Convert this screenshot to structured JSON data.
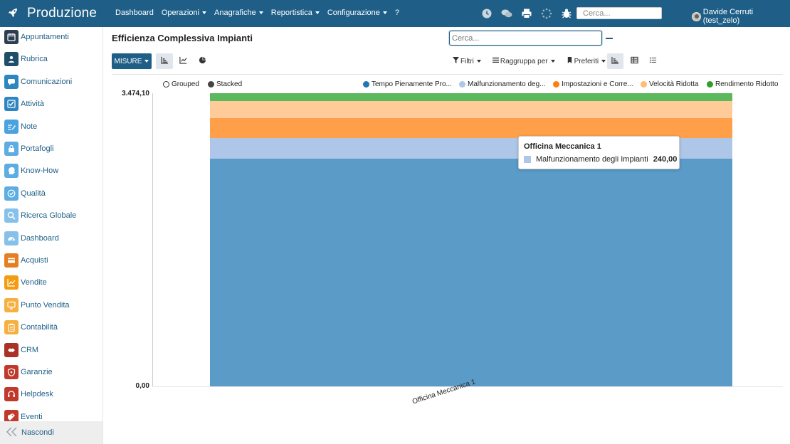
{
  "app": {
    "title": "Produzione"
  },
  "top_menu": [
    {
      "label": "Dashboard",
      "dropdown": false
    },
    {
      "label": "Operazioni",
      "dropdown": true
    },
    {
      "label": "Anagrafiche",
      "dropdown": true
    },
    {
      "label": "Reportistica",
      "dropdown": true
    },
    {
      "label": "Configurazione",
      "dropdown": true
    },
    {
      "label": "?",
      "dropdown": false
    }
  ],
  "top_icons": [
    "clock-icon",
    "chat-icon",
    "print-icon",
    "loading-icon",
    "bug-icon"
  ],
  "top_search": {
    "placeholder": "Cerca..."
  },
  "user": {
    "name": "Davide Cerruti (test_zelo)"
  },
  "sidebar": {
    "items": [
      {
        "label": "Appuntamenti",
        "icon": "calendar-icon",
        "color": "#2c3e50"
      },
      {
        "label": "Rubrica",
        "icon": "contacts-icon",
        "color": "#1f4e6b"
      },
      {
        "label": "Comunicazioni",
        "icon": "speech-bubble-icon",
        "color": "#2e86c1"
      },
      {
        "label": "Attività",
        "icon": "checkbox-icon",
        "color": "#2e86c1"
      },
      {
        "label": "Note",
        "icon": "note-icon",
        "color": "#4aa3df"
      },
      {
        "label": "Portafogli",
        "icon": "lock-icon",
        "color": "#5dade2"
      },
      {
        "label": "Know-How",
        "icon": "head-icon",
        "color": "#5dade2"
      },
      {
        "label": "Qualità",
        "icon": "quality-check-icon",
        "color": "#5dade2"
      },
      {
        "label": "Ricerca Globale",
        "icon": "magnifier-icon",
        "color": "#85c1e9"
      },
      {
        "label": "Dashboard",
        "icon": "dashboard-gauge-icon",
        "color": "#85c1e9"
      },
      {
        "label": "Acquisti",
        "icon": "credit-card-icon",
        "color": "#e67e22"
      },
      {
        "label": "Vendite",
        "icon": "trend-chart-icon",
        "color": "#f39c12"
      },
      {
        "label": "Punto Vendita",
        "icon": "monitor-icon",
        "color": "#f5b041"
      },
      {
        "label": "Contabilità",
        "icon": "clipboard-icon",
        "color": "#f5b041"
      },
      {
        "label": "CRM",
        "icon": "handshake-icon",
        "color": "#a93226"
      },
      {
        "label": "Garanzie",
        "icon": "shield-icon",
        "color": "#c0392b"
      },
      {
        "label": "Helpdesk",
        "icon": "headset-icon",
        "color": "#c0392b"
      },
      {
        "label": "Eventi",
        "icon": "ticket-icon",
        "color": "#c0392b"
      }
    ],
    "footer_label": "Nascondi"
  },
  "page": {
    "title": "Efficienza Complessiva Impianti",
    "search_placeholder": "Cerca..."
  },
  "toolbar": {
    "measures_label": "MISURE",
    "chart_types": [
      "bar-chart-icon",
      "line-chart-icon",
      "pie-chart-icon"
    ],
    "filters_label": "Filtri",
    "group_by_label": "Raggruppa per",
    "favorites_label": "Preferiti",
    "views": [
      "graph-view-icon",
      "pivot-view-icon",
      "list-view-icon"
    ]
  },
  "chart_data": {
    "type": "bar",
    "stacked": true,
    "modes": [
      {
        "label": "Grouped",
        "selected": false
      },
      {
        "label": "Stacked",
        "selected": true
      }
    ],
    "categories": [
      "Officina Meccanica 1"
    ],
    "y_ticks": [
      "3.474,10",
      "0,00"
    ],
    "ylim": [
      0,
      3474.1
    ],
    "legend_position": "top-right",
    "series": [
      {
        "name": "Tempo Pienamente Pro...",
        "color": "#1f77b4",
        "fill": "#5a9bc8",
        "values": [
          2700
        ]
      },
      {
        "name": "Malfunzionamento deg...",
        "color": "#aec7e8",
        "fill": "#aec7e8",
        "values": [
          240
        ]
      },
      {
        "name": "Impostazioni e Corre...",
        "color": "#ff7f0e",
        "fill": "#ff9f4a",
        "values": [
          240
        ]
      },
      {
        "name": "Velocità Ridotta",
        "color": "#ffbb78",
        "fill": "#ffcc99",
        "values": [
          200
        ]
      },
      {
        "name": "Rendimento Ridotto",
        "color": "#2ca02c",
        "fill": "#5cb85c",
        "values": [
          94.1
        ]
      }
    ],
    "tooltip": {
      "title": "Officina Meccanica 1",
      "series_name": "Malfunzionamento degli Impianti",
      "value": "240,00",
      "color": "#aec7e8"
    }
  }
}
